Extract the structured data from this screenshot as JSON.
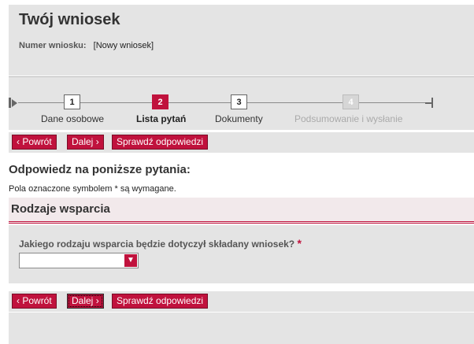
{
  "header": {
    "title": "Twój wniosek",
    "request_number_label": "Numer wniosku:",
    "request_number_value": "[Nowy wniosek]"
  },
  "progress": {
    "steps": [
      {
        "number": "1",
        "label": "Dane osobowe",
        "state": "completed"
      },
      {
        "number": "2",
        "label": "Lista pytań",
        "state": "active"
      },
      {
        "number": "3",
        "label": "Dokumenty",
        "state": "upcoming"
      },
      {
        "number": "4",
        "label": "Podsumowanie i wysłanie",
        "state": "disabled"
      }
    ]
  },
  "nav_buttons": {
    "back_label": "Powrót",
    "next_label": "Dalej",
    "check_label": "Sprawdź odpowiedzi"
  },
  "content": {
    "heading": "Odpowiedz na poniższe pytania:",
    "required_note": "Pola oznaczone symbolem * są wymagane."
  },
  "fieldset": {
    "title": "Rodzaje wsparcia",
    "question": "Jakiego rodzaju wsparcia będzie dotyczył składany wniosek?",
    "required_marker": "*",
    "select_value": ""
  },
  "colors": {
    "accent": "#c0123d",
    "panel": "#e4e4e4",
    "fieldset_bg": "#f2e9eb"
  }
}
